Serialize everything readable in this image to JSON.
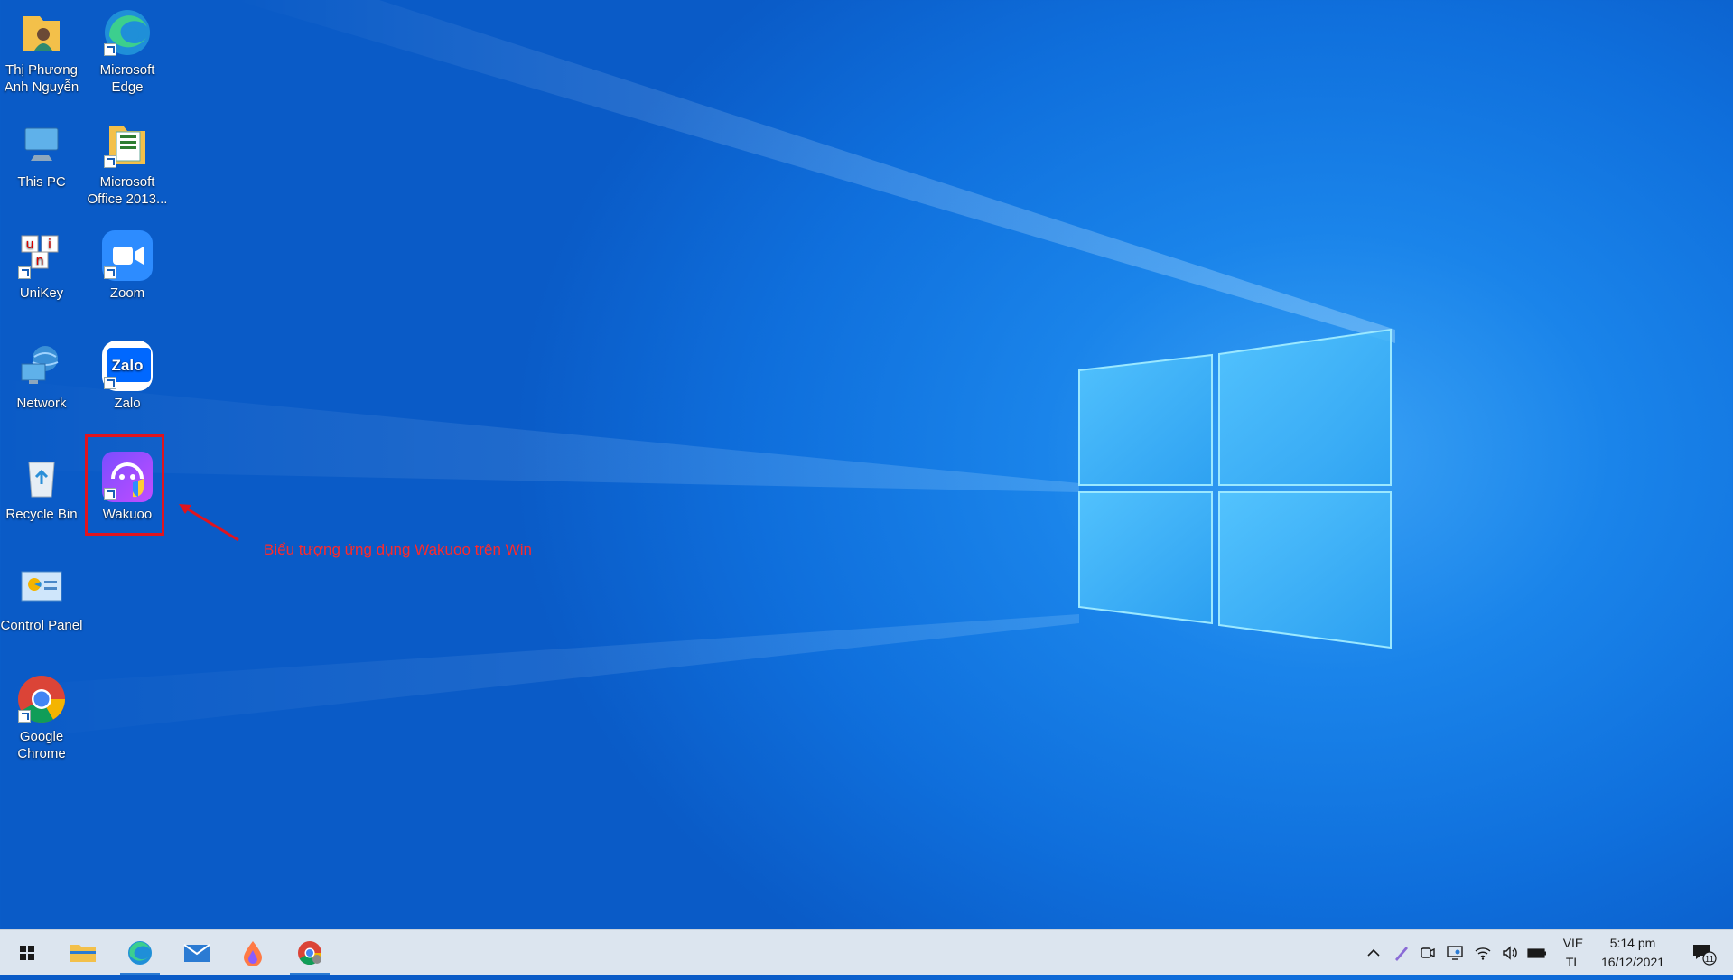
{
  "desktop": {
    "icons": [
      {
        "id": "user-folder",
        "label": "Thị Phương Anh Nguyễn"
      },
      {
        "id": "edge",
        "label": "Microsoft Edge"
      },
      {
        "id": "this-pc",
        "label": "This PC"
      },
      {
        "id": "office",
        "label": "Microsoft Office 2013..."
      },
      {
        "id": "unikey",
        "label": "UniKey"
      },
      {
        "id": "zoom",
        "label": "Zoom"
      },
      {
        "id": "network",
        "label": "Network"
      },
      {
        "id": "zalo",
        "label": "Zalo"
      },
      {
        "id": "recycle",
        "label": "Recycle Bin"
      },
      {
        "id": "wakuoo",
        "label": "Wakuoo"
      },
      {
        "id": "control-panel",
        "label": "Control Panel"
      },
      {
        "id": "chrome",
        "label": "Google Chrome"
      }
    ],
    "zalo_text": "Zalo",
    "unikey_letters": [
      "u",
      "i",
      "n"
    ],
    "annotation": "Biểu tượng ứng dụng Wakuoo trên Win"
  },
  "taskbar": {
    "language": {
      "line1": "VIE",
      "line2": "TL"
    },
    "clock": {
      "time": "5:14 pm",
      "date": "16/12/2021"
    },
    "notifications": "11"
  },
  "colors": {
    "highlight": "#e0141e",
    "annotation": "#ff2a2a",
    "taskbar": "#dce5ef"
  }
}
